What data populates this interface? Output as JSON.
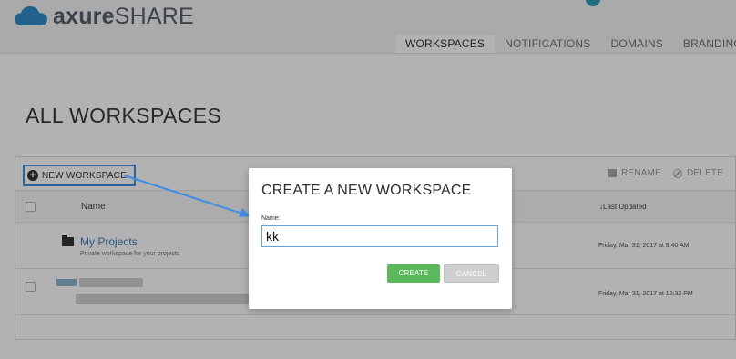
{
  "brand": {
    "logo_bold": "axure",
    "logo_light": "SHARE",
    "icon": "cloud-icon",
    "colors": {
      "cloud": "#2f8dc7",
      "text": "#55606a"
    }
  },
  "nav": {
    "items": [
      {
        "label": "WORKSPACES",
        "active": true
      },
      {
        "label": "NOTIFICATIONS",
        "active": false
      },
      {
        "label": "DOMAINS",
        "active": false
      },
      {
        "label": "BRANDING",
        "active": false
      }
    ]
  },
  "page": {
    "title": "ALL WORKSPACES"
  },
  "toolbar": {
    "new_workspace": "NEW WORKSPACE",
    "rename": "RENAME",
    "delete": "DELETE",
    "accent": "#3d8ee6"
  },
  "table": {
    "columns": {
      "name": "Name",
      "last_updated": "Last Updated"
    },
    "rows": [
      {
        "name": "My Projects",
        "description": "Private workspace for your projects",
        "last_updated": "Friday, Mar 31, 2017 at 9:40 AM"
      },
      {
        "name": "",
        "description": "",
        "last_updated": "Friday, Mar 31, 2017 at 12:32 PM"
      }
    ]
  },
  "dialog": {
    "title": "CREATE A NEW WORKSPACE",
    "name_label": "Name:",
    "name_value": "kk",
    "create_label": "CREATE",
    "cancel_label": "CANCEL",
    "colors": {
      "create": "#5cb85c",
      "cancel": "#cfcfcf"
    }
  }
}
